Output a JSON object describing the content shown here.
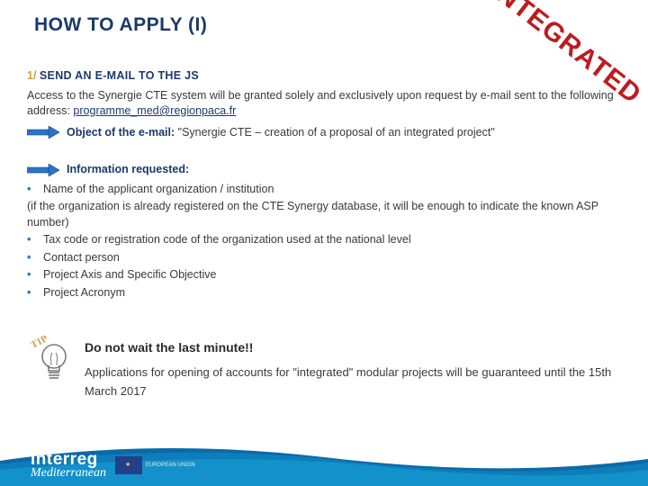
{
  "title": "HOW TO APPLY (I)",
  "stamp": "INTEGRATED",
  "step": {
    "num": "1/",
    "title": "SEND AN E-MAIL TO THE JS"
  },
  "access_before": "Access to the Synergie CTE system will be granted solely and exclusively upon request by e-mail sent to the following address: ",
  "email": "programme_med@regionpaca.fr",
  "object_label": "Object of the e-mail:",
  "object_value": " \"Synergie CTE – creation of a proposal of an integrated project\"",
  "info_req": "Information requested:",
  "note1": "(if the organization is already registered on the CTE Synergy database, it will be enough to indicate the known ASP number)",
  "bullets": {
    "b1": "Name of the applicant organization / institution",
    "b2": "Tax code or registration code of the organization used at the national level",
    "b3": "Contact person",
    "b4": "Project Axis and Specific Objective",
    "b5": "Project Acronym"
  },
  "tip": {
    "label": "TIP",
    "head": "Do not wait the last minute!!",
    "para": "Applications for opening of accounts for \"integrated\" modular projects will be guaranteed until the 15th March 2017"
  },
  "footer": {
    "logo1": "Interreg",
    "logo2": "Mediterranean",
    "eu1": "EUROPEAN UNION",
    "eu2": ""
  }
}
